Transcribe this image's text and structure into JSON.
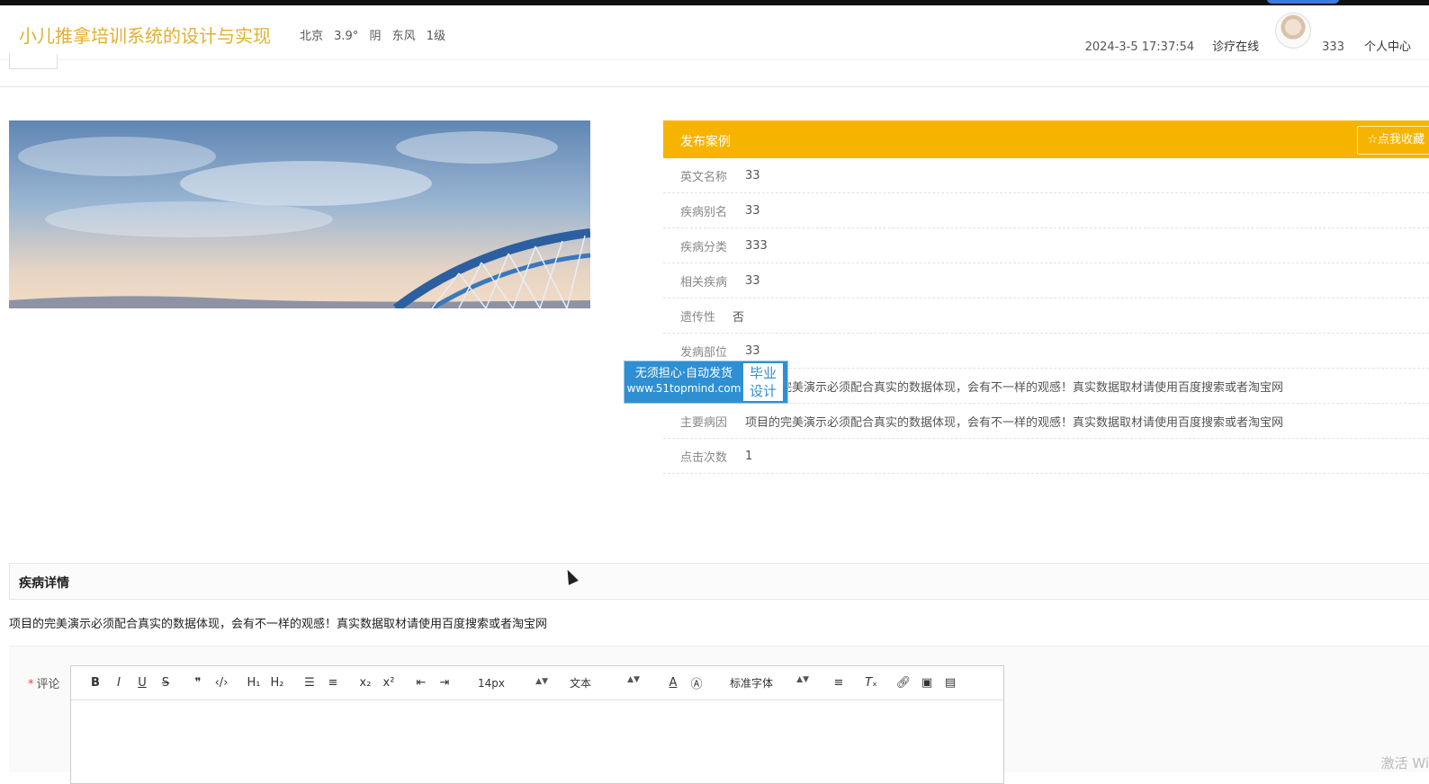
{
  "header": {
    "site_title": "小儿推拿培训系统的设计与实现",
    "weather": {
      "city": "北京",
      "temp": "3.9°",
      "condition": "阴",
      "wind": "东风",
      "level": "1级"
    },
    "datetime": "2024-3-5 17:37:54",
    "nav_link": "诊疗在线",
    "username": "333",
    "user_center": "个人中心"
  },
  "detail": {
    "header_title": "发布案例",
    "favorite_label": "☆点我收藏",
    "fields": [
      {
        "label": "英文名称",
        "value": "33"
      },
      {
        "label": "疾病别名",
        "value": "33"
      },
      {
        "label": "疾病分类",
        "value": "333"
      },
      {
        "label": "相关疾病",
        "value": "33"
      },
      {
        "label": "遗传性",
        "value": "否"
      },
      {
        "label": "发病部位",
        "value": "33"
      },
      {
        "label": "",
        "value": "项目的完美演示必须配合真实的数据体现，会有不一样的观感！真实数据取材请使用百度搜索或者淘宝网"
      },
      {
        "label": "主要病因",
        "value": "项目的完美演示必须配合真实的数据体现，会有不一样的观感！真实数据取材请使用百度搜索或者淘宝网"
      },
      {
        "label": "点击次数",
        "value": "1"
      }
    ]
  },
  "watermark": {
    "line1": "无须担心·自动发货",
    "url": "www.51topmind.com",
    "badge_line1": "毕业",
    "badge_line2": "设计"
  },
  "section": {
    "title": "疾病详情",
    "description": "项目的完美演示必须配合真实的数据体现，会有不一样的观感！真实数据取材请使用百度搜索或者淘宝网"
  },
  "comment": {
    "required_mark": "*",
    "label": "评论",
    "font_size": "14px",
    "text_type": "文本",
    "font_family": "标准字体"
  },
  "os_overlay": "激活 Wi",
  "colors": {
    "accent": "#f6b400",
    "title": "#e0b030",
    "watermark": "#2f8fd3"
  }
}
